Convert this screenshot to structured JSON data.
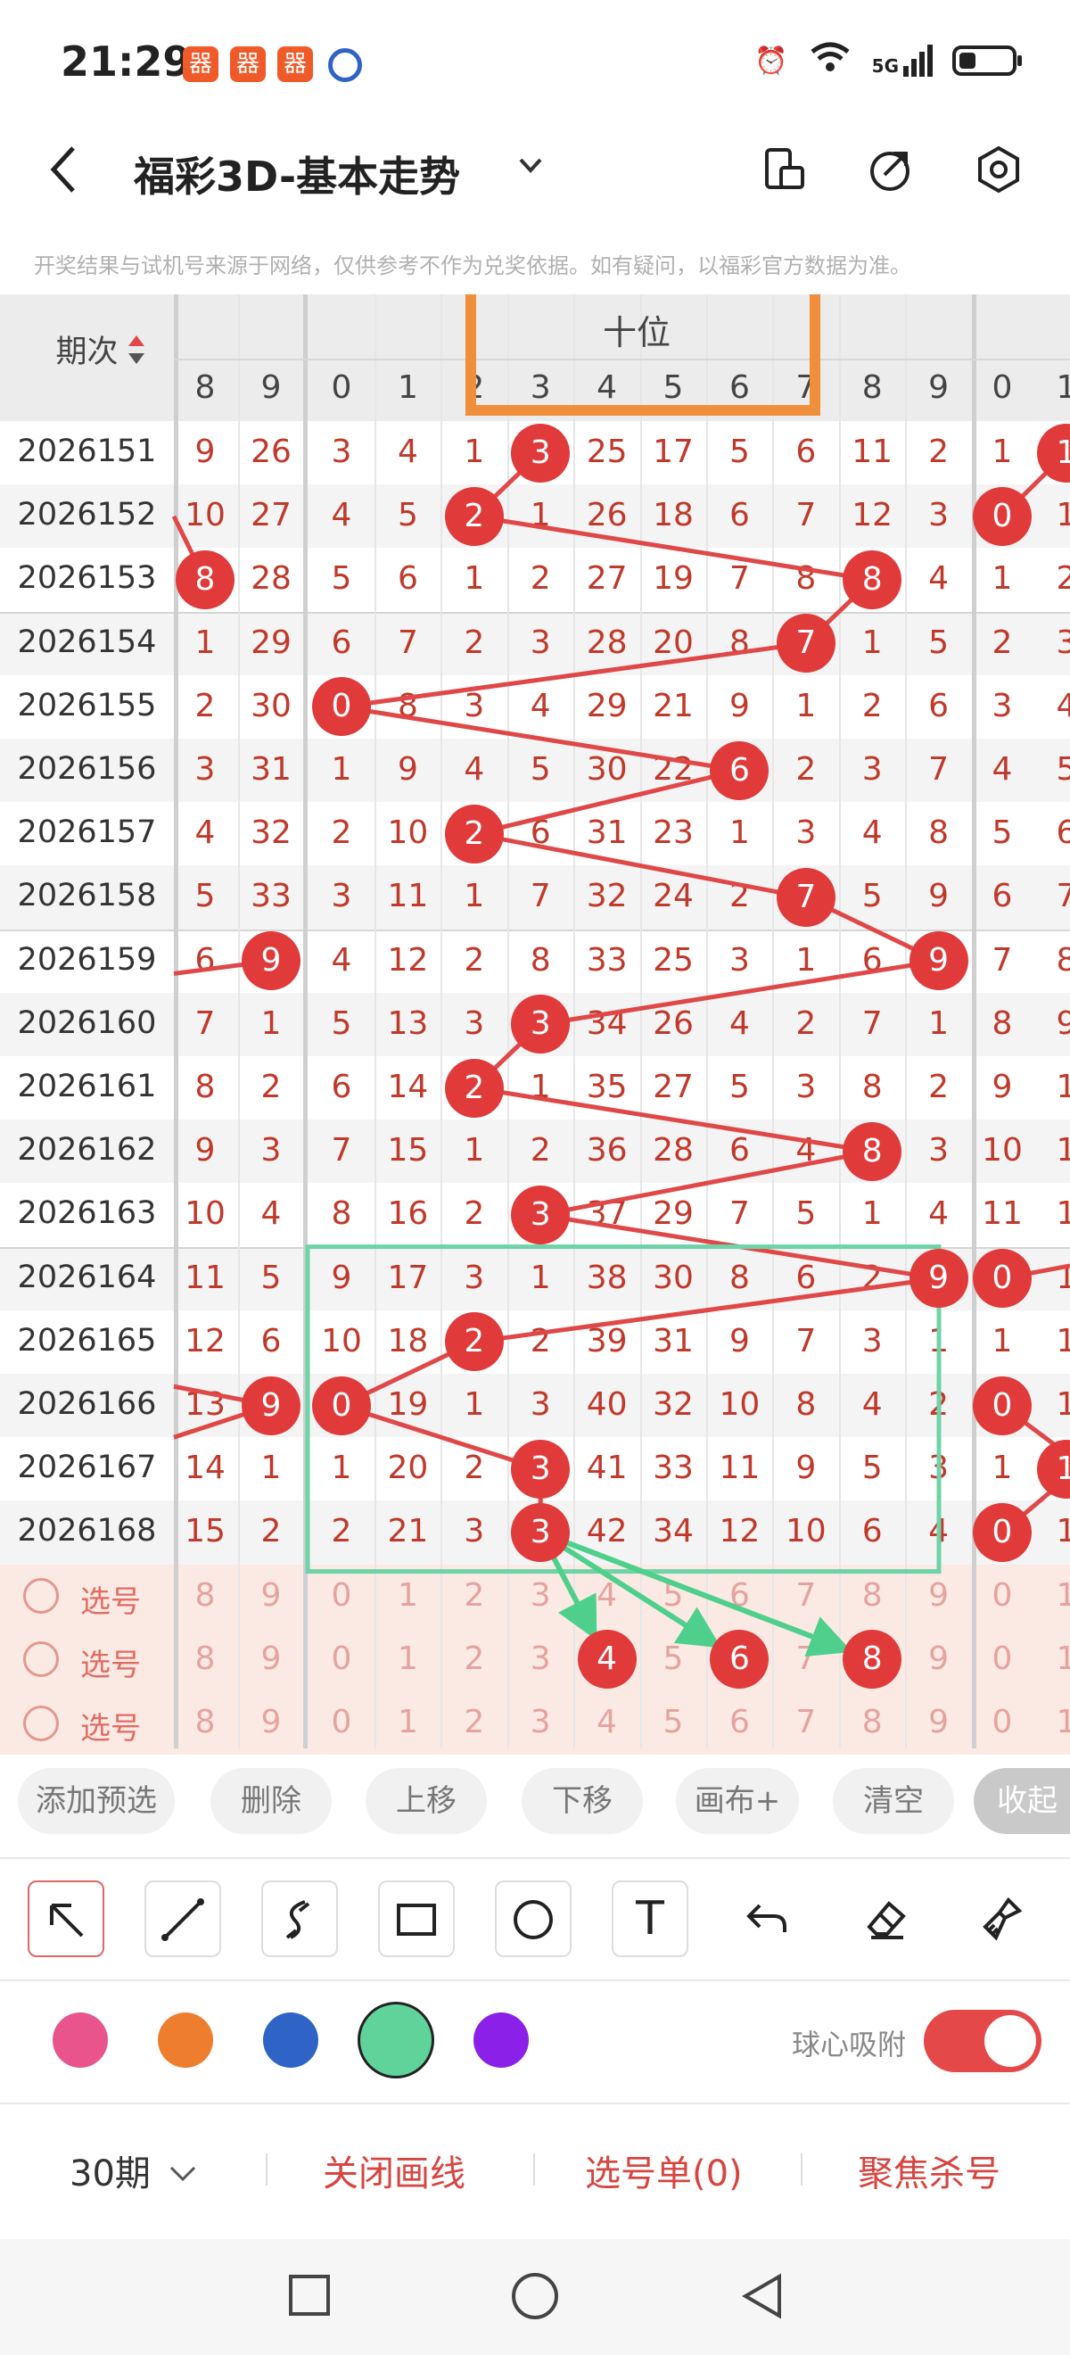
{
  "status": {
    "time": "21:29",
    "notif_glyph": "器",
    "net_label": "5G"
  },
  "header": {
    "title": "福彩3D-基本走势"
  },
  "disclaimer": "开奖结果与试机号来源于网络，仅供参考不作为兑奖依据。如有疑问，以福彩官方数据为准。",
  "table": {
    "period_header": "期次",
    "section_title": "十位",
    "left_cols": [
      "8",
      "9"
    ],
    "mid_cols": [
      "0",
      "1",
      "2",
      "3",
      "4",
      "5",
      "6",
      "7",
      "8",
      "9"
    ],
    "right_cols": [
      "0",
      "1"
    ],
    "rows": [
      {
        "period": "2026151",
        "L": [
          "9",
          "26"
        ],
        "M": [
          "3",
          "4",
          "1",
          "3",
          "25",
          "17",
          "5",
          "6",
          "11",
          "2"
        ],
        "R": [
          "1",
          "1"
        ],
        "hit": 3,
        "rhit": 1
      },
      {
        "period": "2026152",
        "L": [
          "10",
          "27"
        ],
        "M": [
          "4",
          "5",
          "2",
          "1",
          "26",
          "18",
          "6",
          "7",
          "12",
          "3"
        ],
        "R": [
          "0",
          "1"
        ],
        "hit": 2,
        "rhit": 0
      },
      {
        "period": "2026153",
        "L": [
          "8",
          "28"
        ],
        "M": [
          "5",
          "6",
          "1",
          "2",
          "27",
          "19",
          "7",
          "8",
          "8",
          "4"
        ],
        "R": [
          "1",
          "2"
        ],
        "hit": 8,
        "lhit": 0
      },
      {
        "period": "2026154",
        "L": [
          "1",
          "29"
        ],
        "M": [
          "6",
          "7",
          "2",
          "3",
          "28",
          "20",
          "8",
          "7",
          "1",
          "5"
        ],
        "R": [
          "2",
          "3"
        ],
        "hit": 7
      },
      {
        "period": "2026155",
        "L": [
          "2",
          "30"
        ],
        "M": [
          "0",
          "8",
          "3",
          "4",
          "29",
          "21",
          "9",
          "1",
          "2",
          "6"
        ],
        "R": [
          "3",
          "4"
        ],
        "hit": 0
      },
      {
        "period": "2026156",
        "L": [
          "3",
          "31"
        ],
        "M": [
          "1",
          "9",
          "4",
          "5",
          "30",
          "22",
          "6",
          "2",
          "3",
          "7"
        ],
        "R": [
          "4",
          "5"
        ],
        "hit": 6
      },
      {
        "period": "2026157",
        "L": [
          "4",
          "32"
        ],
        "M": [
          "2",
          "10",
          "2",
          "6",
          "31",
          "23",
          "1",
          "3",
          "4",
          "8"
        ],
        "R": [
          "5",
          "6"
        ],
        "hit": 2
      },
      {
        "period": "2026158",
        "L": [
          "5",
          "33"
        ],
        "M": [
          "3",
          "11",
          "1",
          "7",
          "32",
          "24",
          "2",
          "7",
          "5",
          "9"
        ],
        "R": [
          "6",
          "7"
        ],
        "hit": 7
      },
      {
        "period": "2026159",
        "L": [
          "6",
          "9"
        ],
        "M": [
          "4",
          "12",
          "2",
          "8",
          "33",
          "25",
          "3",
          "1",
          "6",
          "9"
        ],
        "R": [
          "7",
          "8"
        ],
        "hit": 9,
        "lhit": 1
      },
      {
        "period": "2026160",
        "L": [
          "7",
          "1"
        ],
        "M": [
          "5",
          "13",
          "3",
          "3",
          "34",
          "26",
          "4",
          "2",
          "7",
          "1"
        ],
        "R": [
          "8",
          "9"
        ],
        "hit": 3
      },
      {
        "period": "2026161",
        "L": [
          "8",
          "2"
        ],
        "M": [
          "6",
          "14",
          "2",
          "1",
          "35",
          "27",
          "5",
          "3",
          "8",
          "2"
        ],
        "R": [
          "9",
          "1"
        ],
        "hit": 2
      },
      {
        "period": "2026162",
        "L": [
          "9",
          "3"
        ],
        "M": [
          "7",
          "15",
          "1",
          "2",
          "36",
          "28",
          "6",
          "4",
          "8",
          "3"
        ],
        "R": [
          "10",
          "1"
        ],
        "hit": 8
      },
      {
        "period": "2026163",
        "L": [
          "10",
          "4"
        ],
        "M": [
          "8",
          "16",
          "2",
          "3",
          "37",
          "29",
          "7",
          "5",
          "1",
          "4"
        ],
        "R": [
          "11",
          "1"
        ],
        "hit": 3
      },
      {
        "period": "2026164",
        "L": [
          "11",
          "5"
        ],
        "M": [
          "9",
          "17",
          "3",
          "1",
          "38",
          "30",
          "8",
          "6",
          "2",
          "9"
        ],
        "R": [
          "0",
          "1"
        ],
        "hit": 9,
        "rhit": 0
      },
      {
        "period": "2026165",
        "L": [
          "12",
          "6"
        ],
        "M": [
          "10",
          "18",
          "2",
          "2",
          "39",
          "31",
          "9",
          "7",
          "3",
          "1"
        ],
        "R": [
          "1",
          "1"
        ],
        "hit": 2
      },
      {
        "period": "2026166",
        "L": [
          "13",
          "9"
        ],
        "M": [
          "0",
          "19",
          "1",
          "3",
          "40",
          "32",
          "10",
          "8",
          "4",
          "2"
        ],
        "R": [
          "0",
          "1"
        ],
        "hit": 0,
        "lhit": 1,
        "rhit": 0
      },
      {
        "period": "2026167",
        "L": [
          "14",
          "1"
        ],
        "M": [
          "1",
          "20",
          "2",
          "3",
          "41",
          "33",
          "11",
          "9",
          "5",
          "3"
        ],
        "R": [
          "1",
          "1"
        ],
        "hit": 3,
        "rhit": 1
      },
      {
        "period": "2026168",
        "L": [
          "15",
          "2"
        ],
        "M": [
          "2",
          "21",
          "3",
          "3",
          "42",
          "34",
          "12",
          "10",
          "6",
          "4"
        ],
        "R": [
          "0",
          "1"
        ],
        "hit": 3,
        "rhit": 0
      }
    ],
    "pick_label": "选号",
    "pick_rows": [
      {
        "L": [
          "8",
          "9"
        ],
        "M": [
          "0",
          "1",
          "2",
          "3",
          "4",
          "5",
          "6",
          "7",
          "8",
          "9"
        ],
        "R": [
          "0",
          "1"
        ],
        "balls": []
      },
      {
        "L": [
          "8",
          "9"
        ],
        "M": [
          "0",
          "1",
          "2",
          "3",
          "4",
          "5",
          "6",
          "7",
          "8",
          "9"
        ],
        "R": [
          "0",
          "1"
        ],
        "balls": [
          4,
          6,
          8
        ]
      },
      {
        "L": [
          "8",
          "9"
        ],
        "M": [
          "0",
          "1",
          "2",
          "3",
          "4",
          "5",
          "6",
          "7",
          "8",
          "9"
        ],
        "R": [
          "0",
          "1"
        ],
        "balls": []
      }
    ]
  },
  "actions": [
    "添加预选",
    "删除",
    "上移",
    "下移",
    "画布+",
    "清空",
    "收起"
  ],
  "tools": {
    "text_glyph": "T"
  },
  "colors": {
    "swatches": [
      "#e8548b",
      "#ef7d2e",
      "#2f63c6",
      "#5fd39a",
      "#8b21e8"
    ],
    "selected_index": 3,
    "line_red": "#e04848",
    "arrow_green": "#4fcf8c",
    "box_green": "#6fd3a8",
    "highlight_orange": "#ef8f3c"
  },
  "snap_label": "球心吸附",
  "bottom": {
    "period_select": "30期",
    "close_lines": "关闭画线",
    "pick_list": "选号单(0)",
    "focus_kill": "聚焦杀号"
  }
}
